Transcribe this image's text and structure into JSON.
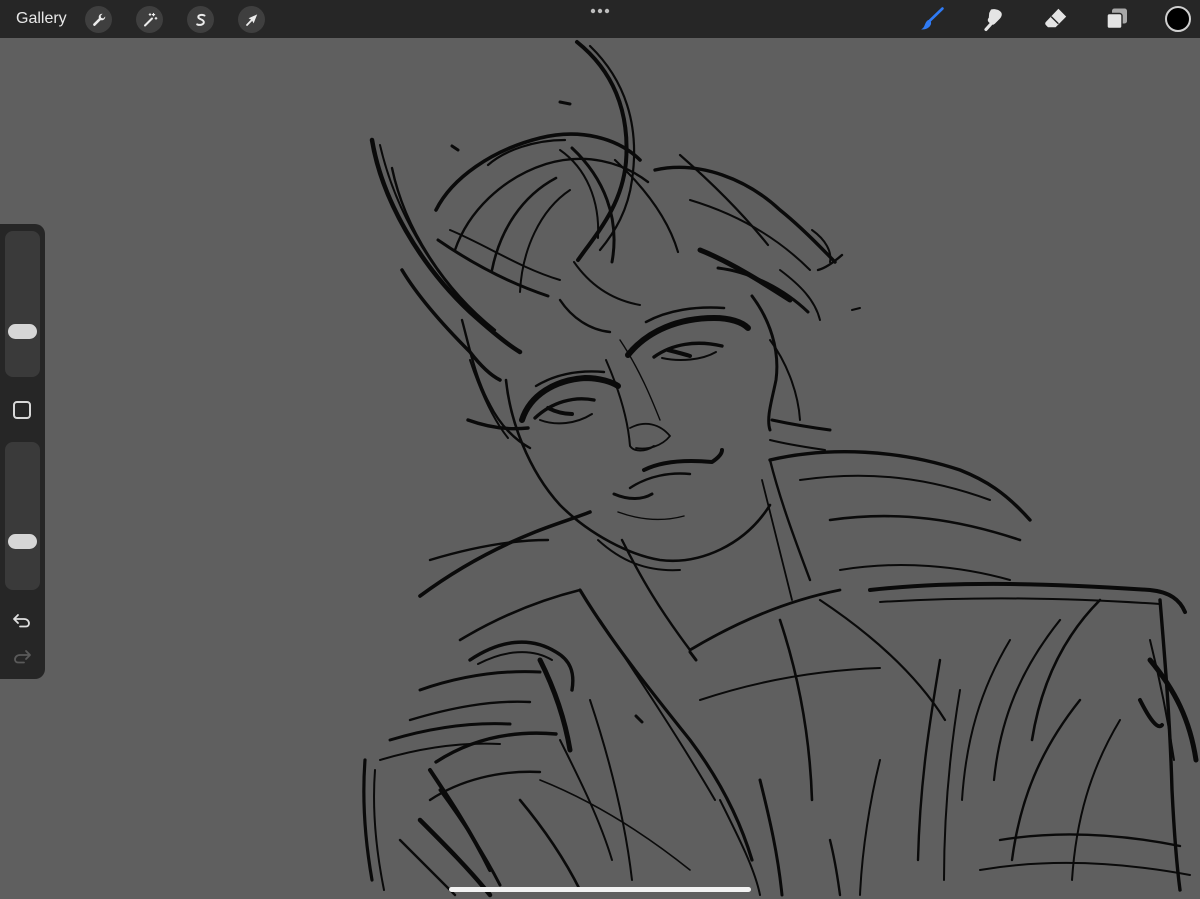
{
  "toolbar": {
    "gallery_label": "Gallery",
    "left_tools": [
      {
        "name": "actions",
        "icon": "wrench-icon"
      },
      {
        "name": "adjustments",
        "icon": "magic-wand-icon"
      },
      {
        "name": "selection",
        "icon": "selection-s-icon"
      },
      {
        "name": "transform",
        "icon": "arrow-cursor-icon"
      }
    ],
    "more_icon": "more-dots-icon",
    "right_tools": [
      {
        "name": "brush",
        "icon": "brush-icon",
        "active": true
      },
      {
        "name": "smudge",
        "icon": "smudge-icon",
        "active": false
      },
      {
        "name": "eraser",
        "icon": "eraser-icon",
        "active": false
      },
      {
        "name": "layers",
        "icon": "layers-icon",
        "active": false
      }
    ],
    "current_color": "#000000",
    "active_tool_color": "#2f7bf5"
  },
  "sidebar": {
    "brush_size_level": 0.28,
    "opacity_level": 0.3,
    "modify_icon": "square-icon",
    "undo_icon": "undo-icon",
    "redo_icon": "redo-icon",
    "redo_enabled": false
  },
  "canvas": {
    "background_color": "#5f5f5f",
    "stroke_color": "#0a0a0a",
    "content": "sketch-drawing"
  }
}
